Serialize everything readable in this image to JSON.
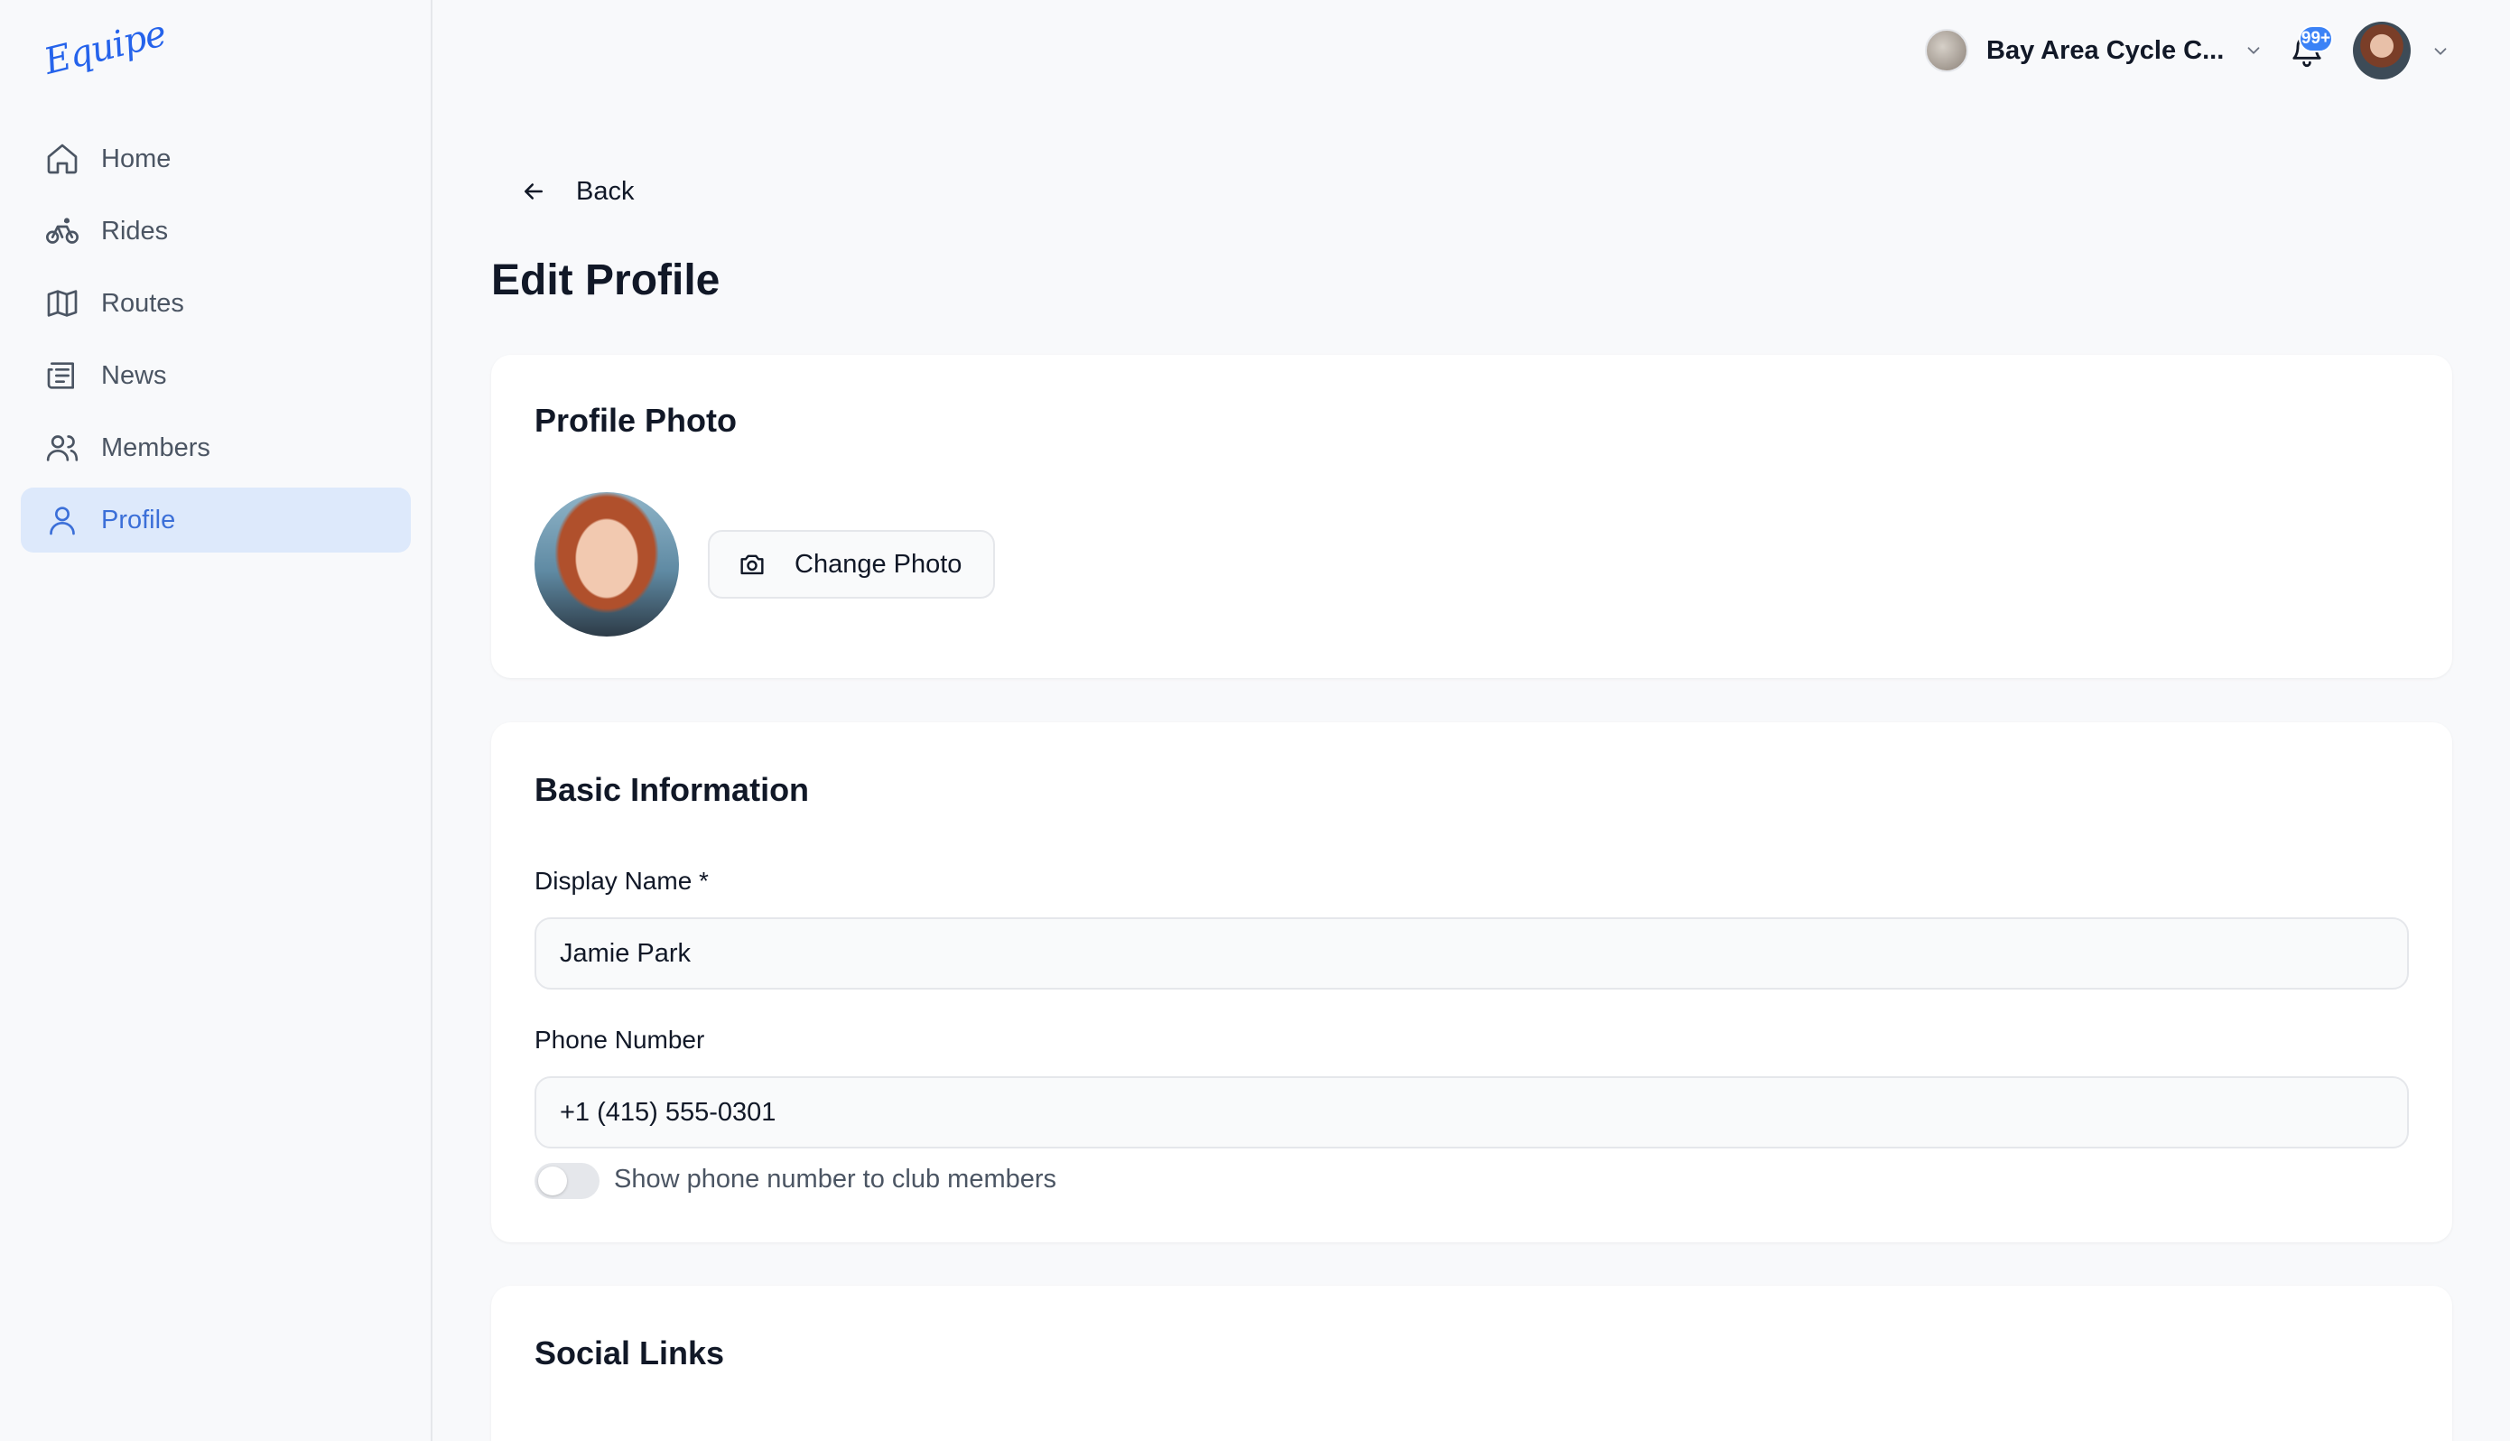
{
  "app": {
    "logo_text": "Equipe"
  },
  "sidebar": {
    "items": [
      {
        "label": "Home",
        "icon": "home-icon",
        "active": false
      },
      {
        "label": "Rides",
        "icon": "bicycle-icon",
        "active": false
      },
      {
        "label": "Routes",
        "icon": "map-icon",
        "active": false
      },
      {
        "label": "News",
        "icon": "newspaper-icon",
        "active": false
      },
      {
        "label": "Members",
        "icon": "users-icon",
        "active": false
      },
      {
        "label": "Profile",
        "icon": "user-icon",
        "active": true
      }
    ]
  },
  "header": {
    "club_name": "Bay Area Cycle C...",
    "notification_count": "99+"
  },
  "main": {
    "back_label": "Back",
    "page_title": "Edit Profile",
    "profile_photo": {
      "title": "Profile Photo",
      "change_button": "Change Photo"
    },
    "basic_info": {
      "title": "Basic Information",
      "display_name_label": "Display Name *",
      "display_name_value": "Jamie Park",
      "phone_label": "Phone Number",
      "phone_value": "+1 (415) 555-0301",
      "show_phone_label": "Show phone number to club members",
      "show_phone_enabled": false
    },
    "social_links": {
      "title": "Social Links"
    }
  },
  "colors": {
    "accent": "#3b6fd8",
    "active_bg": "#dde9fb",
    "badge": "#3b82f6",
    "page_bg": "#f8f9fb"
  }
}
